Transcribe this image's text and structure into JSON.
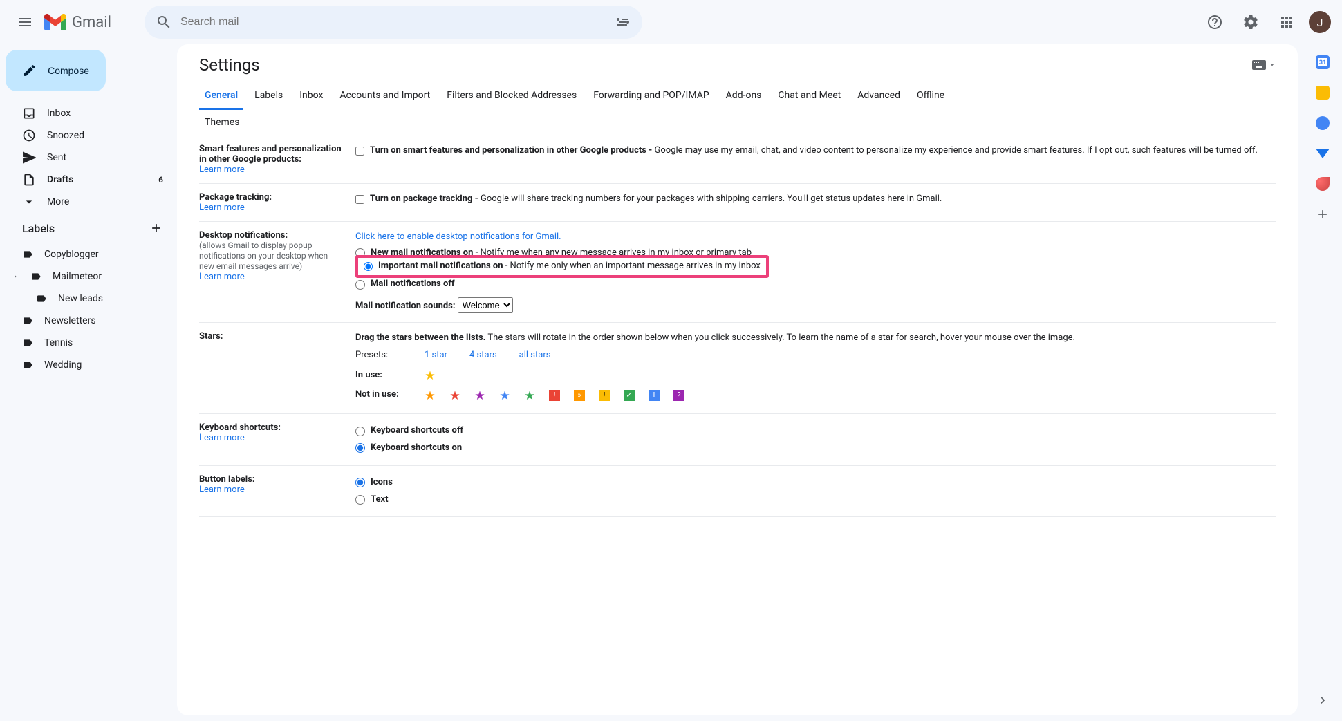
{
  "header": {
    "appName": "Gmail",
    "searchPlaceholder": "Search mail",
    "avatarLetter": "J"
  },
  "sidebar": {
    "compose": "Compose",
    "nav": [
      {
        "label": "Inbox",
        "bold": false
      },
      {
        "label": "Snoozed",
        "bold": false
      },
      {
        "label": "Sent",
        "bold": false
      },
      {
        "label": "Drafts",
        "bold": true,
        "count": "6"
      },
      {
        "label": "More",
        "bold": false
      }
    ],
    "labelsHeader": "Labels",
    "labels": [
      {
        "label": "Copyblogger"
      },
      {
        "label": "Mailmeteor",
        "expandable": true
      },
      {
        "label": "New leads",
        "child": true
      },
      {
        "label": "Newsletters"
      },
      {
        "label": "Tennis"
      },
      {
        "label": "Wedding"
      }
    ]
  },
  "settings": {
    "title": "Settings",
    "tabs": [
      "General",
      "Labels",
      "Inbox",
      "Accounts and Import",
      "Filters and Blocked Addresses",
      "Forwarding and POP/IMAP",
      "Add-ons",
      "Chat and Meet",
      "Advanced",
      "Offline",
      "Themes"
    ],
    "activeTab": "General",
    "learnMore": "Learn more",
    "smartFeatures": {
      "title": "Smart features and personalization in other Google products:",
      "optionBold": "Turn on smart features and personalization in other Google products -",
      "optionDesc": " Google may use my email, chat, and video content to personalize my experience and provide smart features. If I opt out, such features will be turned off."
    },
    "packageTracking": {
      "title": "Package tracking:",
      "optionBold": "Turn on package tracking -",
      "optionDesc": " Google will share tracking numbers for your packages with shipping carriers. You'll get status updates here in Gmail."
    },
    "desktopNotifications": {
      "title": "Desktop notifications:",
      "sub": "(allows Gmail to display popup notifications on your desktop when new email messages arrive)",
      "enableLink": "Click here to enable desktop notifications for Gmail.",
      "opt1Bold": "New mail notifications on",
      "opt1Desc": " - Notify me when any new message arrives in my inbox or primary tab",
      "opt2Bold": "Important mail notifications on",
      "opt2Desc": " - Notify me only when an important message arrives in my inbox",
      "opt3Bold": "Mail notifications off",
      "soundsLabel": "Mail notification sounds:",
      "soundsValue": "Welcome"
    },
    "stars": {
      "title": "Stars:",
      "dragBold": "Drag the stars between the lists.",
      "dragDesc": "  The stars will rotate in the order shown below when you click successively. To learn the name of a star for search, hover your mouse over the image.",
      "presetsLabel": "Presets:",
      "preset1": "1 star",
      "preset4": "4 stars",
      "presetAll": "all stars",
      "inUseLabel": "In use:",
      "notInUseLabel": "Not in use:"
    },
    "keyboard": {
      "title": "Keyboard shortcuts:",
      "off": "Keyboard shortcuts off",
      "on": "Keyboard shortcuts on"
    },
    "buttonLabels": {
      "title": "Button labels:",
      "icons": "Icons",
      "text": "Text"
    }
  }
}
